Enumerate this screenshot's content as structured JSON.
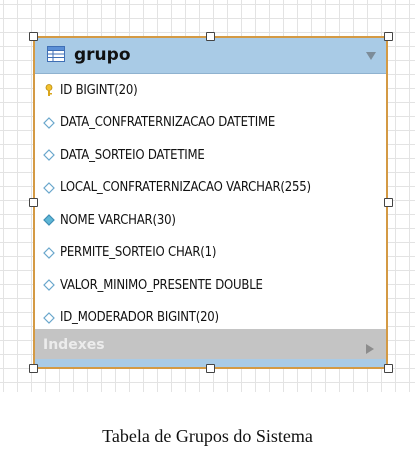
{
  "table": {
    "title": "grupo",
    "columns": [
      {
        "label": "ID BIGINT(20)",
        "icon": "primary-key-icon"
      },
      {
        "label": "DATA_CONFRATERNIZACAO DATETIME",
        "icon": "column-diamond-icon"
      },
      {
        "label": "DATA_SORTEIO DATETIME",
        "icon": "column-diamond-icon"
      },
      {
        "label": "LOCAL_CONFRATERNIZACAO VARCHAR(255)",
        "icon": "column-diamond-icon"
      },
      {
        "label": "NOME VARCHAR(30)",
        "icon": "not-null-diamond-icon"
      },
      {
        "label": "PERMITE_SORTEIO CHAR(1)",
        "icon": "column-diamond-icon"
      },
      {
        "label": "VALOR_MINIMO_PRESENTE DOUBLE",
        "icon": "column-diamond-icon"
      },
      {
        "label": "ID_MODERADOR BIGINT(20)",
        "icon": "column-diamond-icon"
      }
    ],
    "indexes_label": "Indexes"
  },
  "caption": "Tabela de Grupos do Sistema",
  "colors": {
    "header": "#a9cbe6",
    "border": "#d49a44",
    "indexes_bar": "#c4c4c4"
  }
}
